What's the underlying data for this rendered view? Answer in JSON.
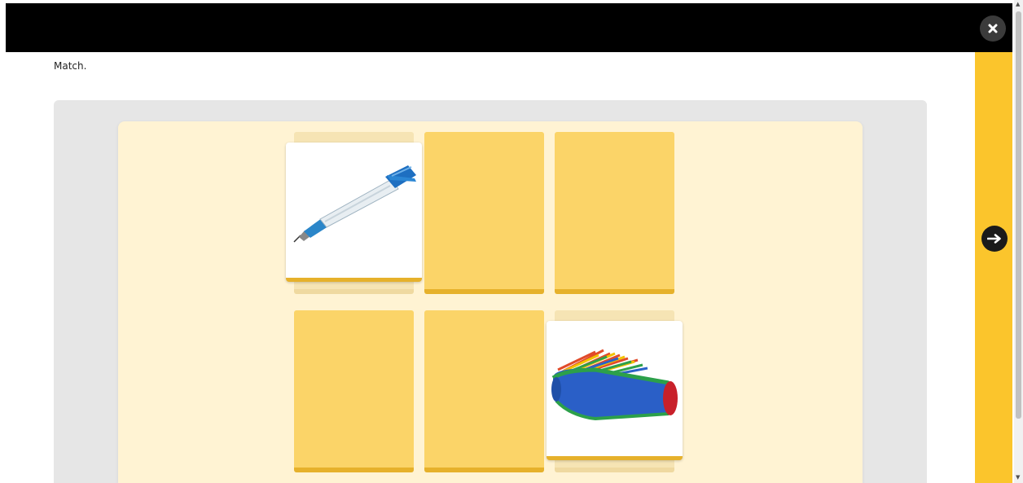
{
  "header": {
    "close_icon": "close-icon"
  },
  "activity": {
    "instruction": "Match.",
    "cards": [
      {
        "state": "face-up",
        "picture": "pen"
      },
      {
        "state": "face-down"
      },
      {
        "state": "face-down"
      },
      {
        "state": "face-down"
      },
      {
        "state": "face-down"
      },
      {
        "state": "face-up",
        "picture": "pencil-case"
      }
    ]
  },
  "navigation": {
    "next_icon": "arrow-right-icon"
  },
  "colors": {
    "top_bar": "#000000",
    "side_panel": "#fbc52c",
    "card_back": "#fbd468",
    "board": "#fff3d3",
    "stage": "#e6e6e6"
  }
}
